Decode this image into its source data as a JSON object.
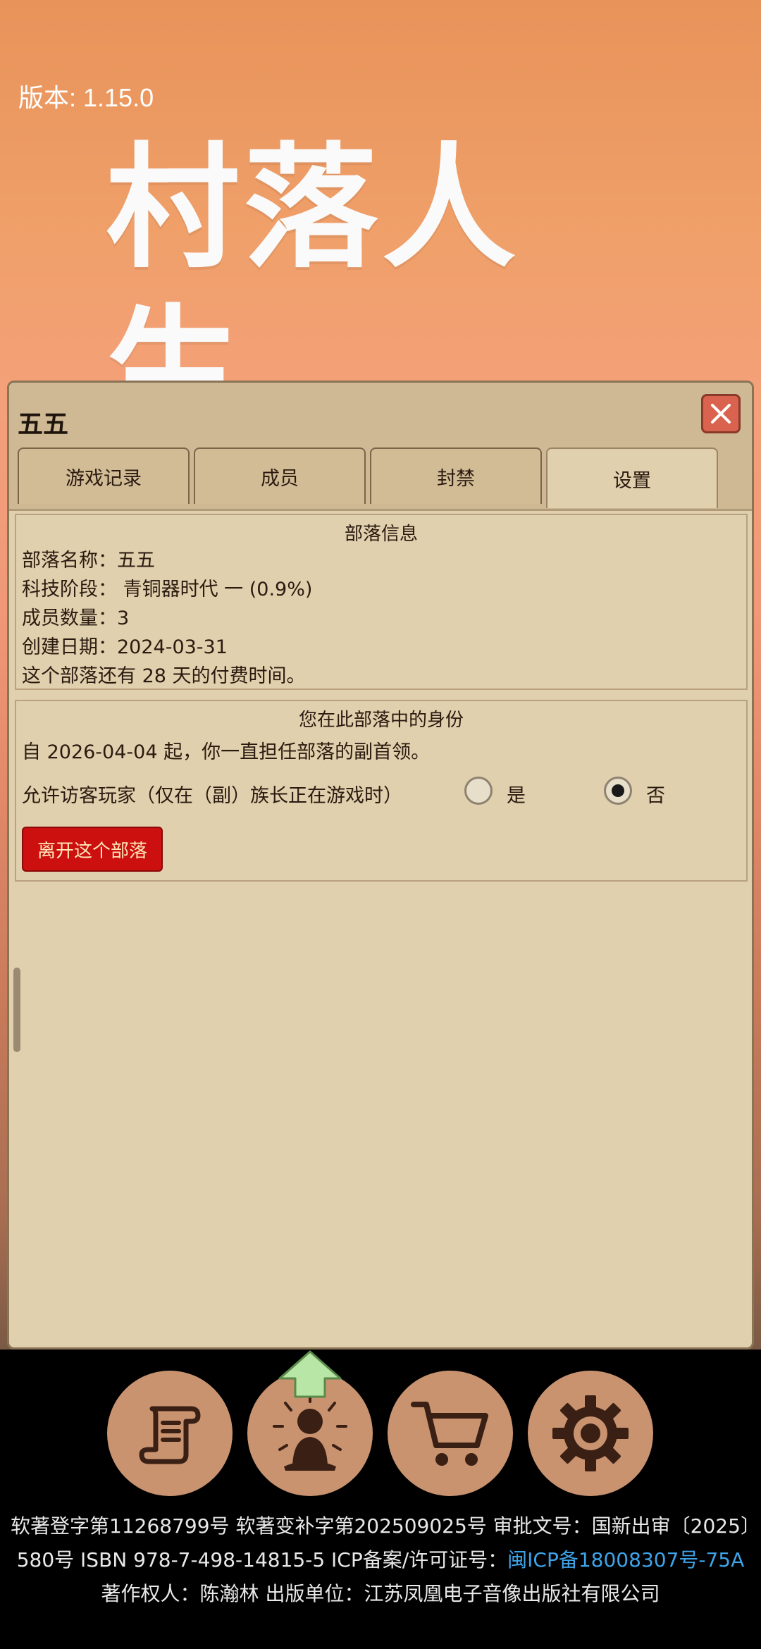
{
  "app": {
    "version": "版本: 1.15.0",
    "logo_text": "村落人生"
  },
  "panel": {
    "title": "五五",
    "tabs": [
      {
        "label": "游戏记录",
        "active": false
      },
      {
        "label": "成员",
        "active": false
      },
      {
        "label": "封禁",
        "active": false
      },
      {
        "label": "设置",
        "active": true
      }
    ],
    "tribe_info": {
      "heading": "部落信息",
      "name": "部落名称：五五",
      "tech_stage": "科技阶段： 青铜器时代 一 (0.9%)",
      "member_count": "成员数量：3",
      "created": "创建日期：2024-03-31",
      "paid_time": "这个部落还有 28 天的付费时间。"
    },
    "identity": {
      "heading": "您在此部落中的身份",
      "role_text": "自 2026-04-04 起，你一直担任部落的副首领。",
      "visitor_label": "允许访客玩家（仅在（副）族长正在游戏时）",
      "option_yes": "是",
      "option_no": "否",
      "selected": "否",
      "leave_button": "离开这个部落"
    }
  },
  "nav": {
    "icons": [
      "scroll-icon",
      "meditation-icon",
      "cart-icon",
      "gear-icon"
    ]
  },
  "footer": {
    "line1": "软著登字第11268799号 软著变补字第202509025号 审批文号：国新出审〔2025〕580号 ISBN 978-7-498-14815-5 ICP备案/许可证号：",
    "icp_link": "闽ICP备18008307号-75A",
    "line2": "著作权人：陈瀚林 出版单位：江苏凤凰电子音像出版社有限公司"
  },
  "colors": {
    "accent_red": "#cc0f0f",
    "panel_bg": "#e0d0ad",
    "nav_button": "#c99370",
    "link": "#3fa3e8"
  }
}
